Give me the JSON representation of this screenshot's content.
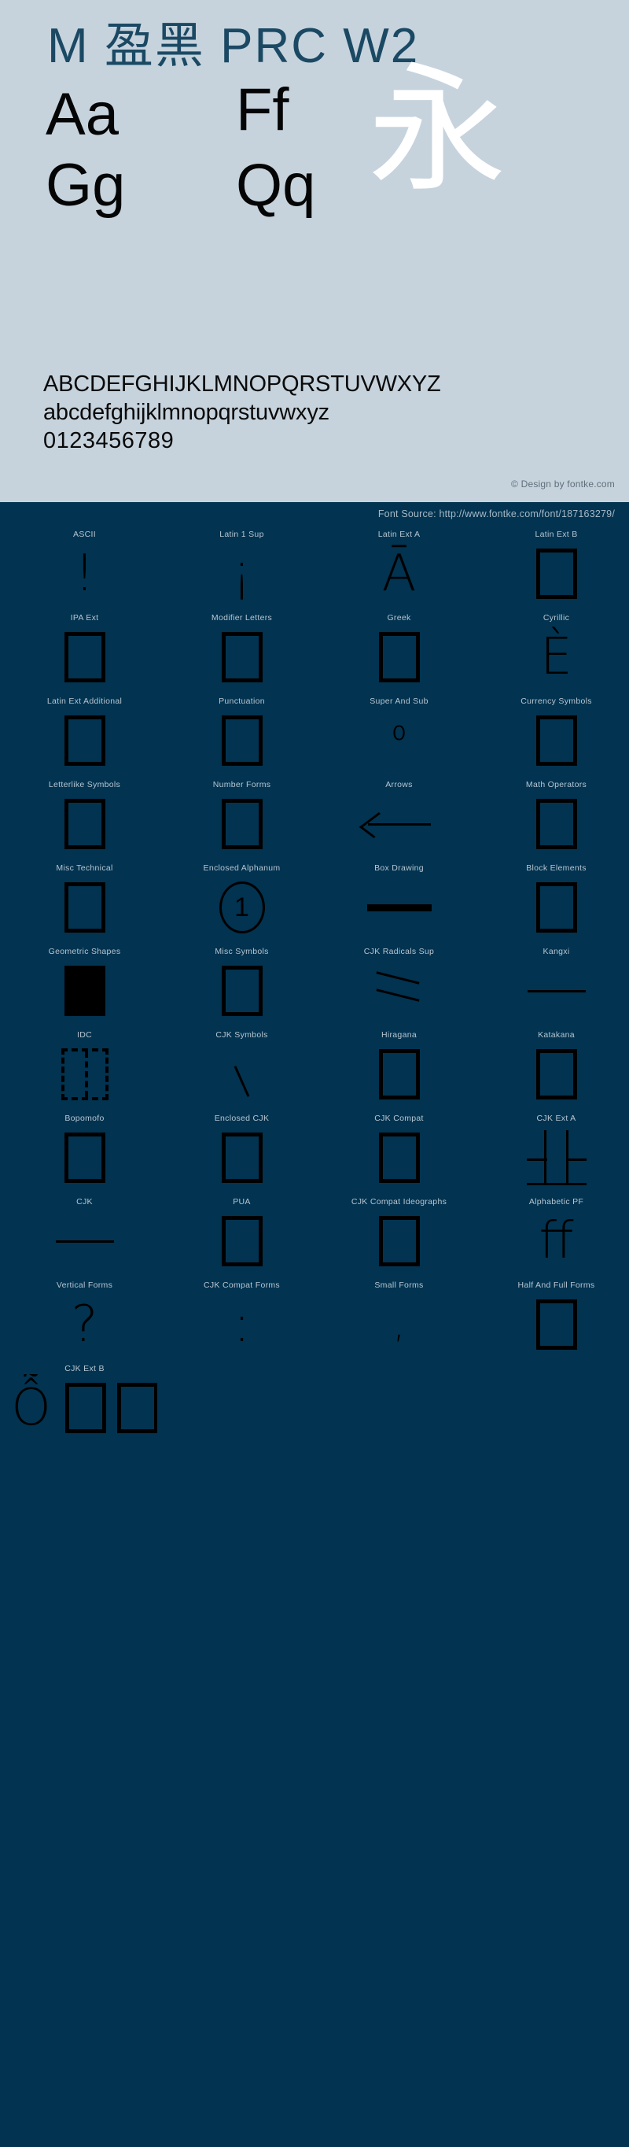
{
  "header": {
    "font_title": "M 盈黑 PRC W2",
    "samples": [
      {
        "name": "sample-aa",
        "text": "Aa"
      },
      {
        "name": "sample-ff",
        "text": "Ff"
      },
      {
        "name": "sample-gg",
        "text": "Gg"
      },
      {
        "name": "sample-qq",
        "text": "Qq"
      }
    ],
    "cjk_sample": "永",
    "alphabet_upper": "ABCDEFGHIJKLMNOPQRSTUVWXYZ",
    "alphabet_lower": "abcdefghijklmnopqrstuvwxyz",
    "digits": "0123456789",
    "design_credit": "© Design by fontke.com",
    "font_source": "Font Source: http://www.fontke.com/font/187163279/"
  },
  "colors": {
    "header_background": "#c6d3dd",
    "page_background": "#023350",
    "title_color": "#1b4964",
    "sample_glyph_color": "#050505",
    "cjk_sample_color": "#ffffff",
    "block_label_color": "#b7c6d2",
    "block_glyph_color": "#000000",
    "credit_color": "#5f6f7b",
    "source_color": "#a6b9c6"
  },
  "blocks": [
    {
      "label": "ASCII",
      "glyph": "!",
      "kind": "text"
    },
    {
      "label": "Latin 1 Sup",
      "glyph": "¡",
      "kind": "text"
    },
    {
      "label": "Latin Ext A",
      "glyph": "Ā",
      "kind": "text"
    },
    {
      "label": "Latin Ext B",
      "glyph": "□",
      "kind": "box"
    },
    {
      "label": "IPA Ext",
      "glyph": "□",
      "kind": "box"
    },
    {
      "label": "Modifier Letters",
      "glyph": "□",
      "kind": "box"
    },
    {
      "label": "Greek",
      "glyph": "□",
      "kind": "box"
    },
    {
      "label": "Cyrillic",
      "glyph": "È",
      "kind": "text"
    },
    {
      "label": "Latin Ext Additional",
      "glyph": "□",
      "kind": "box"
    },
    {
      "label": "Punctuation",
      "glyph": "□",
      "kind": "box"
    },
    {
      "label": "Super And Sub",
      "glyph": "⁰",
      "kind": "text-small"
    },
    {
      "label": "Currency Symbols",
      "glyph": "□",
      "kind": "box"
    },
    {
      "label": "Letterlike Symbols",
      "glyph": "□",
      "kind": "box"
    },
    {
      "label": "Number Forms",
      "glyph": "□",
      "kind": "box"
    },
    {
      "label": "Arrows",
      "glyph": "←",
      "kind": "arrow-left"
    },
    {
      "label": "Math Operators",
      "glyph": "□",
      "kind": "box"
    },
    {
      "label": "Misc Technical",
      "glyph": "□",
      "kind": "box"
    },
    {
      "label": "Enclosed Alphanum",
      "glyph": "①",
      "kind": "circled-one"
    },
    {
      "label": "Box Drawing",
      "glyph": "▬",
      "kind": "hline-thick"
    },
    {
      "label": "Block Elements",
      "glyph": "□",
      "kind": "box"
    },
    {
      "label": "Geometric Shapes",
      "glyph": "■",
      "kind": "box-filled"
    },
    {
      "label": "Misc Symbols",
      "glyph": "□",
      "kind": "box"
    },
    {
      "label": "CJK Radicals Sup",
      "glyph": "⺀",
      "kind": "two-strokes"
    },
    {
      "label": "Kangxi",
      "glyph": "一",
      "kind": "hline"
    },
    {
      "label": "IDC",
      "glyph": "⿰",
      "kind": "box-dashed"
    },
    {
      "label": "CJK Symbols",
      "glyph": "、",
      "kind": "slash"
    },
    {
      "label": "Hiragana",
      "glyph": "□",
      "kind": "box"
    },
    {
      "label": "Katakana",
      "glyph": "□",
      "kind": "box"
    },
    {
      "label": "Bopomofo",
      "glyph": "□",
      "kind": "box"
    },
    {
      "label": "Enclosed CJK",
      "glyph": "□",
      "kind": "box"
    },
    {
      "label": "CJK Compat",
      "glyph": "□",
      "kind": "box"
    },
    {
      "label": "CJK Ext A",
      "glyph": "北",
      "kind": "bei"
    },
    {
      "label": "CJK",
      "glyph": "一",
      "kind": "hline"
    },
    {
      "label": "PUA",
      "glyph": "□",
      "kind": "box"
    },
    {
      "label": "CJK Compat Ideographs",
      "glyph": "□",
      "kind": "box"
    },
    {
      "label": "Alphabetic PF",
      "glyph": "ﬀ",
      "kind": "text"
    },
    {
      "label": "Vertical Forms",
      "glyph": "?",
      "kind": "text"
    },
    {
      "label": "CJK Compat Forms",
      "glyph": ":",
      "kind": "text"
    },
    {
      "label": "Small Forms",
      "glyph": ",",
      "kind": "text-small"
    },
    {
      "label": "Half And Full Forms",
      "glyph": "□",
      "kind": "box"
    },
    {
      "label": "CJK Ext B",
      "glyph": "Ỗ□□",
      "kind": "ext-b"
    }
  ]
}
